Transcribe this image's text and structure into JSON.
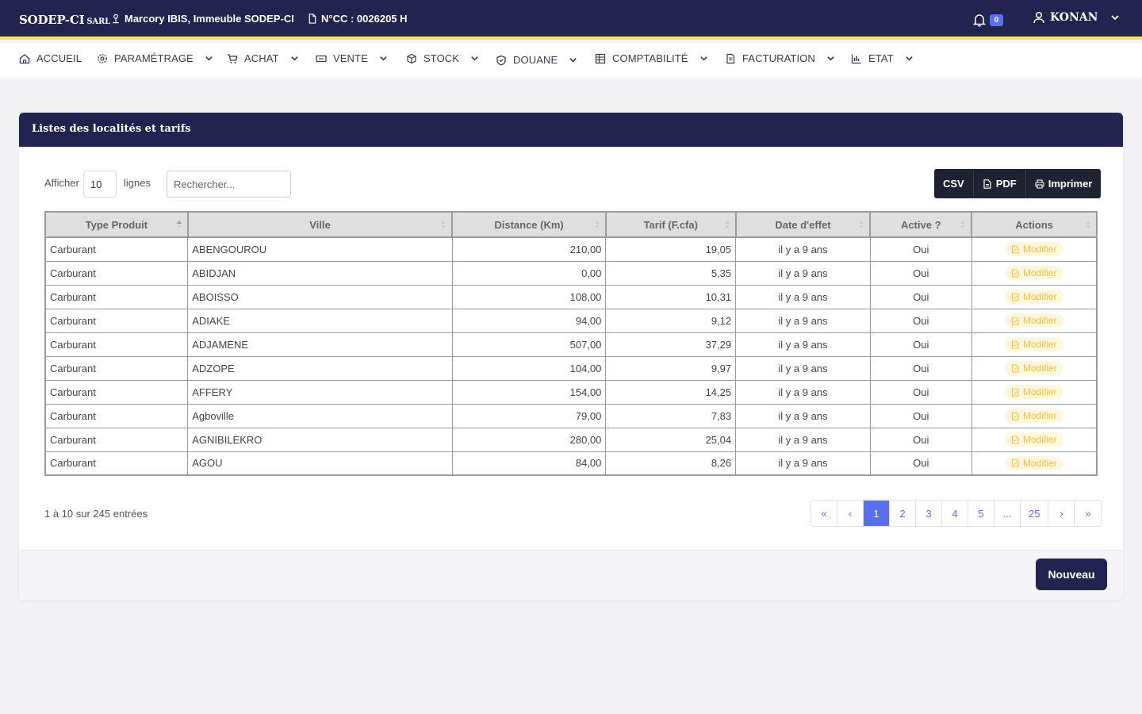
{
  "topbar": {
    "brand": "SODEP-CI",
    "brand_suffix": "SARL",
    "address": "Marcory IBIS, Immeuble SODEP-CI",
    "ncc": "N°CC : 0026205 H",
    "notifications": "0",
    "user": "KONAN"
  },
  "nav": [
    {
      "label": "ACCUEIL",
      "icon": "home-icon"
    },
    {
      "label": "PARAMÉTRAGE",
      "icon": "gear-icon"
    },
    {
      "label": "ACHAT",
      "icon": "cart-icon"
    },
    {
      "label": "VENTE",
      "icon": "ticket-icon"
    },
    {
      "label": "STOCK",
      "icon": "box-icon"
    },
    {
      "label": "DOUANE",
      "icon": "shield-icon"
    },
    {
      "label": "COMPTABILITÉ",
      "icon": "ledger-icon"
    },
    {
      "label": "FACTURATION",
      "icon": "invoice-icon"
    },
    {
      "label": "ETAT",
      "icon": "bar-chart-icon"
    }
  ],
  "card": {
    "title": "Listes des localités et tarifs",
    "show_label": "Afficher",
    "page_size": "10",
    "lines_label": "lignes",
    "search_placeholder": "Rechercher..."
  },
  "export": {
    "csv": "CSV",
    "pdf": "PDF",
    "print": "Imprimer"
  },
  "table": {
    "headers": [
      "Type Produit",
      "Ville",
      "Distance (Km)",
      "Tarif (F.cfa)",
      "Date d'effet",
      "Active ?",
      "Actions"
    ],
    "action_label": "Modifier",
    "rows": [
      [
        "Carburant",
        "ABENGOUROU",
        "210,00",
        "19,05",
        "il y a 9 ans",
        "Oui"
      ],
      [
        "Carburant",
        "ABIDJAN",
        "0,00",
        "5,35",
        "il y a 9 ans",
        "Oui"
      ],
      [
        "Carburant",
        "ABOISSO",
        "108,00",
        "10,31",
        "il y a 9 ans",
        "Oui"
      ],
      [
        "Carburant",
        "ADIAKE",
        "94,00",
        "9,12",
        "il y a 9 ans",
        "Oui"
      ],
      [
        "Carburant",
        "ADJAMENE",
        "507,00",
        "37,29",
        "il y a 9 ans",
        "Oui"
      ],
      [
        "Carburant",
        "ADZOPE",
        "104,00",
        "9,97",
        "il y a 9 ans",
        "Oui"
      ],
      [
        "Carburant",
        "AFFERY",
        "154,00",
        "14,25",
        "il y a 9 ans",
        "Oui"
      ],
      [
        "Carburant",
        "Agboville",
        "79,00",
        "7,83",
        "il y a 9 ans",
        "Oui"
      ],
      [
        "Carburant",
        "AGNIBILEKRO",
        "280,00",
        "25,04",
        "il y a 9 ans",
        "Oui"
      ],
      [
        "Carburant",
        "AGOU",
        "84,00",
        "8,26",
        "il y a 9 ans",
        "Oui"
      ]
    ]
  },
  "footer": {
    "info": "1 à 10 sur 245 entrées",
    "pages": [
      "«",
      "‹",
      "1",
      "2",
      "3",
      "4",
      "5",
      "...",
      "25",
      "›",
      "»"
    ],
    "active_page": "1",
    "new_button": "Nouveau"
  },
  "colors": {
    "primary": "#23234f",
    "accent": "#5a6ff0",
    "highlight": "#f3e64b",
    "warning": "#f4c13a"
  }
}
